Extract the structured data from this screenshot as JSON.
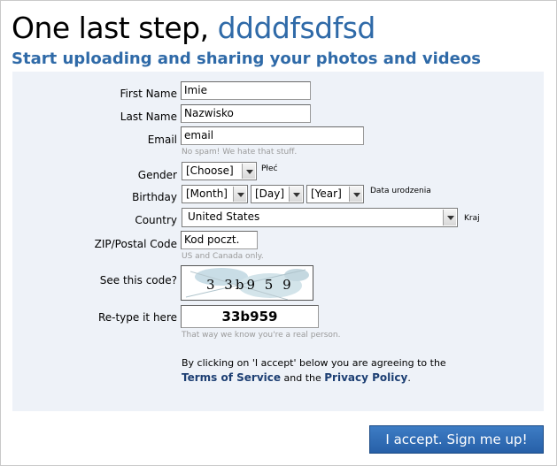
{
  "header": {
    "title_prefix": "One last step,",
    "username": "ddddfsdfsd",
    "subtitle": "Start uploading and sharing your photos and videos"
  },
  "form": {
    "first_name": {
      "label": "First Name",
      "value": "Imie"
    },
    "last_name": {
      "label": "Last Name",
      "value": "Nazwisko"
    },
    "email": {
      "label": "Email",
      "value": "email",
      "hint": "No spam! We hate that stuff."
    },
    "gender": {
      "label": "Gender",
      "selected": "[Choose]",
      "side_label": "Płeć"
    },
    "birthday": {
      "label": "Birthday",
      "month": "[Month]",
      "day": "[Day]",
      "year": "[Year]",
      "side_label": "Data urodzenia"
    },
    "country": {
      "label": "Country",
      "selected": "United States",
      "side_label": "Kraj"
    },
    "zip": {
      "label": "ZIP/Postal Code",
      "value": "Kod poczt.",
      "hint": "US and Canada only."
    },
    "captcha": {
      "label": "See this code?",
      "code_image_text": "3 3b9 5 9"
    },
    "retype": {
      "label": "Re-type it here",
      "value": "33b959",
      "hint": "That way we know you're a real person."
    },
    "agreement": {
      "text_before": "By clicking on 'I accept' below you are agreeing to the",
      "terms_link": "Terms of Service",
      "conjunction": "and the",
      "privacy_link": "Privacy Policy",
      "end": "."
    }
  },
  "submit_label": "I accept. Sign me up!",
  "colors": {
    "accent": "#2f6aa8",
    "panel_bg": "#eef2f8",
    "button": "#2f6eb6",
    "link": "#1d3f73"
  }
}
